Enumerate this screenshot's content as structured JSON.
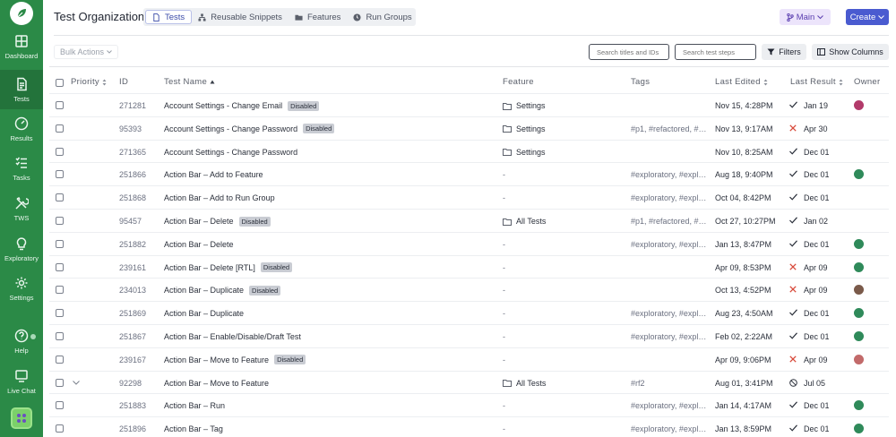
{
  "sidebar": {
    "items": [
      {
        "label": "Dashboard",
        "icon": "grid-icon",
        "active": false
      },
      {
        "label": "Tests",
        "icon": "document-icon",
        "active": true
      },
      {
        "label": "Results",
        "icon": "gauge-icon",
        "active": false
      },
      {
        "label": "Tasks",
        "icon": "checklist-icon",
        "active": false
      },
      {
        "label": "TWS",
        "icon": "tools-icon",
        "active": false
      },
      {
        "label": "Exploratory",
        "icon": "lightbulb-icon",
        "active": false
      },
      {
        "label": "Settings",
        "icon": "gear-icon",
        "active": false
      },
      {
        "label": "Help",
        "icon": "help-icon",
        "active": false
      },
      {
        "label": "Live Chat",
        "icon": "chat-icon",
        "active": false
      }
    ]
  },
  "header": {
    "org_title": "Test Organization",
    "tabs": [
      {
        "label": "Tests",
        "icon": "document-icon",
        "active": true
      },
      {
        "label": "Reusable Snippets",
        "icon": "hierarchy-icon",
        "active": false
      },
      {
        "label": "Features",
        "icon": "folder-icon",
        "active": false
      },
      {
        "label": "Run Groups",
        "icon": "clock-icon",
        "active": false
      }
    ],
    "branch_label": "Main",
    "create_label": "Create"
  },
  "toolbar": {
    "bulk_label": "Bulk Actions",
    "search_titles_placeholder": "Search titles and IDs",
    "search_steps_placeholder": "Search test steps",
    "filters_label": "Filters",
    "show_columns_label": "Show Columns"
  },
  "table": {
    "columns": [
      "Priority",
      "ID",
      "Test Name",
      "Feature",
      "Tags",
      "Last Edited",
      "Last Result",
      "Owner"
    ],
    "rows": [
      {
        "id": "271281",
        "name": "Account Settings - Change Email",
        "badge": "Disabled",
        "feature": "Settings",
        "tags": "",
        "edited": "Nov 15, 4:28PM",
        "status": "pass",
        "result": "Jan 19",
        "avatar": "#b23a6a"
      },
      {
        "id": "95393",
        "name": "Account Settings - Change Password",
        "badge": "Disabled",
        "feature": "Settings",
        "tags": "#p1, #refactored, #…",
        "edited": "Nov 13, 9:17AM",
        "status": "fail",
        "result": "Apr 30",
        "avatar": ""
      },
      {
        "id": "271365",
        "name": "Account Settings - Change Password",
        "badge": "",
        "feature": "Settings",
        "tags": "",
        "edited": "Nov 10, 8:25AM",
        "status": "pass",
        "result": "Dec 01",
        "avatar": ""
      },
      {
        "id": "251866",
        "name": "Action Bar – Add to Feature",
        "badge": "",
        "feature": "-",
        "tags": "#exploratory, #expl…",
        "edited": "Aug 18, 9:40PM",
        "status": "pass",
        "result": "Dec 01",
        "avatar": "#2f8a5a"
      },
      {
        "id": "251868",
        "name": "Action Bar – Add to Run Group",
        "badge": "",
        "feature": "-",
        "tags": "#exploratory, #expl…",
        "edited": "Oct 04, 8:42PM",
        "status": "pass",
        "result": "Dec 01",
        "avatar": ""
      },
      {
        "id": "95457",
        "name": "Action Bar – Delete",
        "badge": "Disabled",
        "feature": "All Tests",
        "tags": "#p1, #refactored, #…",
        "edited": "Oct 27, 10:27PM",
        "status": "pass",
        "result": "Jan 02",
        "avatar": ""
      },
      {
        "id": "251882",
        "name": "Action Bar – Delete",
        "badge": "",
        "feature": "-",
        "tags": "#exploratory, #expl…",
        "edited": "Jan 13, 8:47PM",
        "status": "pass",
        "result": "Dec 01",
        "avatar": "#2f8a5a"
      },
      {
        "id": "239161",
        "name": "Action Bar – Delete [RTL]",
        "badge": "Disabled",
        "feature": "-",
        "tags": "",
        "edited": "Apr 09, 8:53PM",
        "status": "fail",
        "result": "Apr 09",
        "avatar": "#2f8a5a"
      },
      {
        "id": "234013",
        "name": "Action Bar – Duplicate",
        "badge": "Disabled",
        "feature": "-",
        "tags": "",
        "edited": "Oct 13, 4:52PM",
        "status": "fail",
        "result": "Apr 09",
        "avatar": "#7a5a4a"
      },
      {
        "id": "251869",
        "name": "Action Bar – Duplicate",
        "badge": "",
        "feature": "-",
        "tags": "#exploratory, #expl…",
        "edited": "Aug 23, 4:50AM",
        "status": "pass",
        "result": "Dec 01",
        "avatar": "#2f8a5a"
      },
      {
        "id": "251867",
        "name": "Action Bar – Enable/Disable/Draft Test",
        "badge": "",
        "feature": "-",
        "tags": "#exploratory, #expl…",
        "edited": "Feb 02, 2:22AM",
        "status": "pass",
        "result": "Dec 01",
        "avatar": "#2f8a5a"
      },
      {
        "id": "239167",
        "name": "Action Bar – Move to Feature",
        "badge": "Disabled",
        "feature": "-",
        "tags": "",
        "edited": "Apr 09, 9:06PM",
        "status": "fail",
        "result": "Apr 09",
        "avatar": "#c26a6a"
      },
      {
        "id": "92298",
        "name": "Action Bar – Move to Feature",
        "badge": "",
        "feature": "All Tests",
        "tags": "#rf2",
        "edited": "Aug 01, 3:41PM",
        "status": "skip",
        "result": "Jul 05",
        "avatar": "",
        "expand": true
      },
      {
        "id": "251883",
        "name": "Action Bar – Run",
        "badge": "",
        "feature": "-",
        "tags": "#exploratory, #expl…",
        "edited": "Jan 14, 4:17AM",
        "status": "pass",
        "result": "Dec 01",
        "avatar": "#2f8a5a"
      },
      {
        "id": "251896",
        "name": "Action Bar – Tag",
        "badge": "",
        "feature": "-",
        "tags": "#exploratory, #expl…",
        "edited": "Jan 13, 8:59PM",
        "status": "pass",
        "result": "Dec 01",
        "avatar": "#2f8a5a"
      }
    ]
  }
}
